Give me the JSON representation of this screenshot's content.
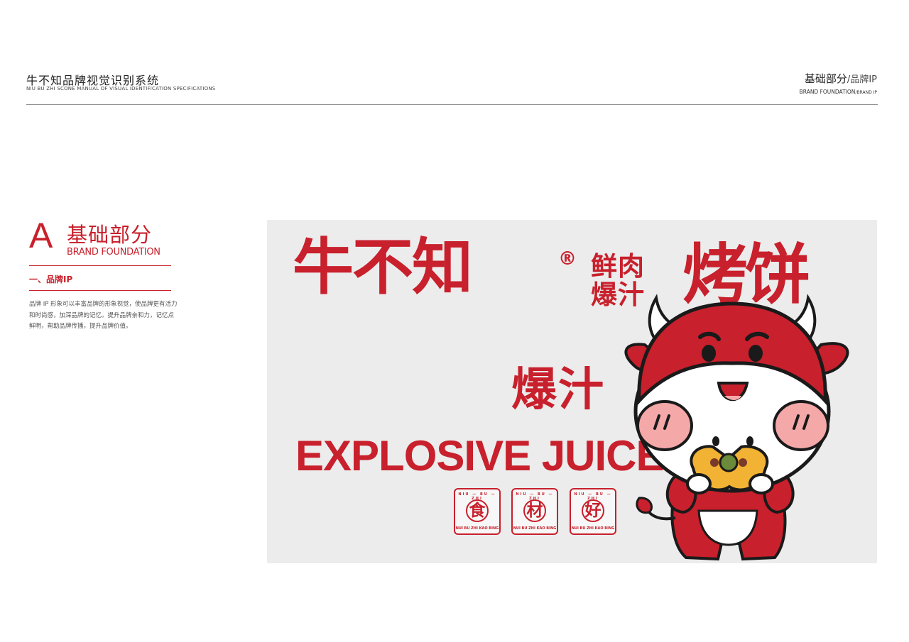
{
  "header": {
    "title": "牛不知品牌视觉识别系统",
    "subtitle": "NIU BU ZHI SCONE MANUAL OF VISUAL IDENTIFICATION SPECIFICATIONS",
    "section": "基础部分",
    "slash": "/",
    "section_sub": "品牌IP",
    "section_en": "BRAND FOUNDATION",
    "section_sub_en": "/BRAND IP"
  },
  "sidebar": {
    "letter": "A",
    "heading": "基础部分",
    "heading_en": "BRAND FOUNDATION",
    "subheading": "一、品牌IP",
    "description": "品牌 IP 形象可以丰富品牌的形象视觉，使品牌更有活力和时尚感，加深品牌的记忆。提升品牌亲和力，记忆点鲜明，帮助品牌传播，提升品牌价值。"
  },
  "panel": {
    "brand_name": "牛不知",
    "registered": "®",
    "tag_line1": "鲜肉",
    "tag_line2": "爆汁",
    "product": "烤饼",
    "burst_cn": "爆汁",
    "burst_en": "EXPLOSIVE JUICE",
    "stamps": [
      {
        "top": "NIU — BU — ZHI",
        "char": "食",
        "bottom": "NUI BU ZHI KAO BING"
      },
      {
        "top": "NIU — BU — ZHI",
        "char": "材",
        "bottom": "NUI BU ZHI KAO BING"
      },
      {
        "top": "NIU — BU — ZHI",
        "char": "好",
        "bottom": "NUI BU ZHI KAO BING"
      }
    ]
  },
  "colors": {
    "brand_red": "#c8202c",
    "panel_bg": "#ececec",
    "bun_yellow": "#f2b233"
  }
}
